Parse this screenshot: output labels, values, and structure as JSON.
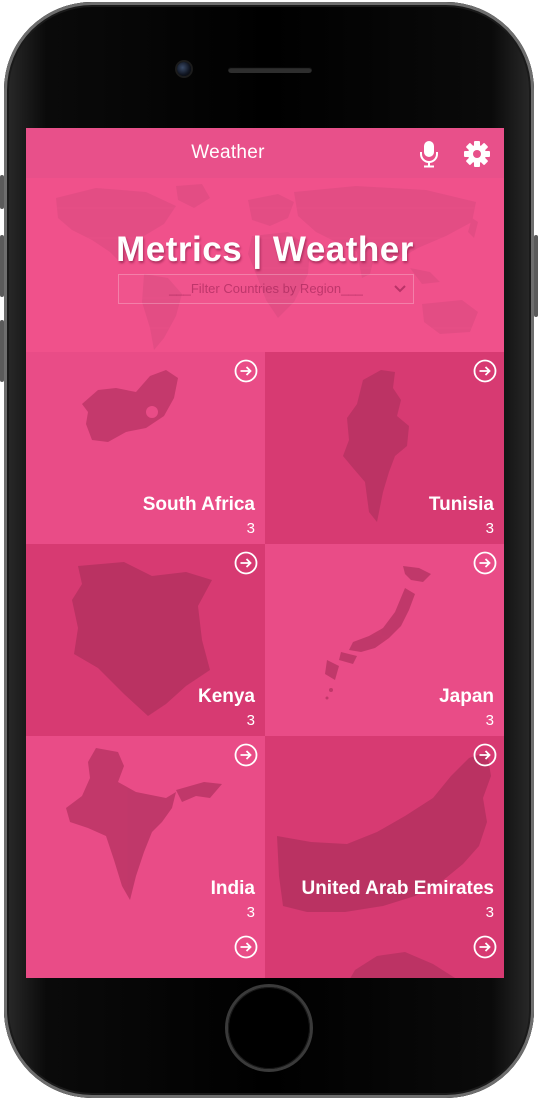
{
  "app": {
    "title": "Weather",
    "header_icons": [
      "microphone-icon",
      "gear-icon"
    ]
  },
  "hero": {
    "title": "Metrics | Weather",
    "region_filter": {
      "placeholder": "___Filter Countries by Region___"
    }
  },
  "colors": {
    "header": "#e8508a",
    "hero": "#f0518b",
    "tile_light": "#e94c87",
    "tile_dark": "#d73a72",
    "map_shape": "#b0305e"
  },
  "countries": [
    {
      "name": "South Africa",
      "count": "3"
    },
    {
      "name": "Tunisia",
      "count": "3"
    },
    {
      "name": "Kenya",
      "count": "3"
    },
    {
      "name": "Japan",
      "count": "3"
    },
    {
      "name": "India",
      "count": "3"
    },
    {
      "name": "United Arab Emirates",
      "count": "3"
    },
    {
      "name": "",
      "count": ""
    },
    {
      "name": "",
      "count": ""
    }
  ]
}
